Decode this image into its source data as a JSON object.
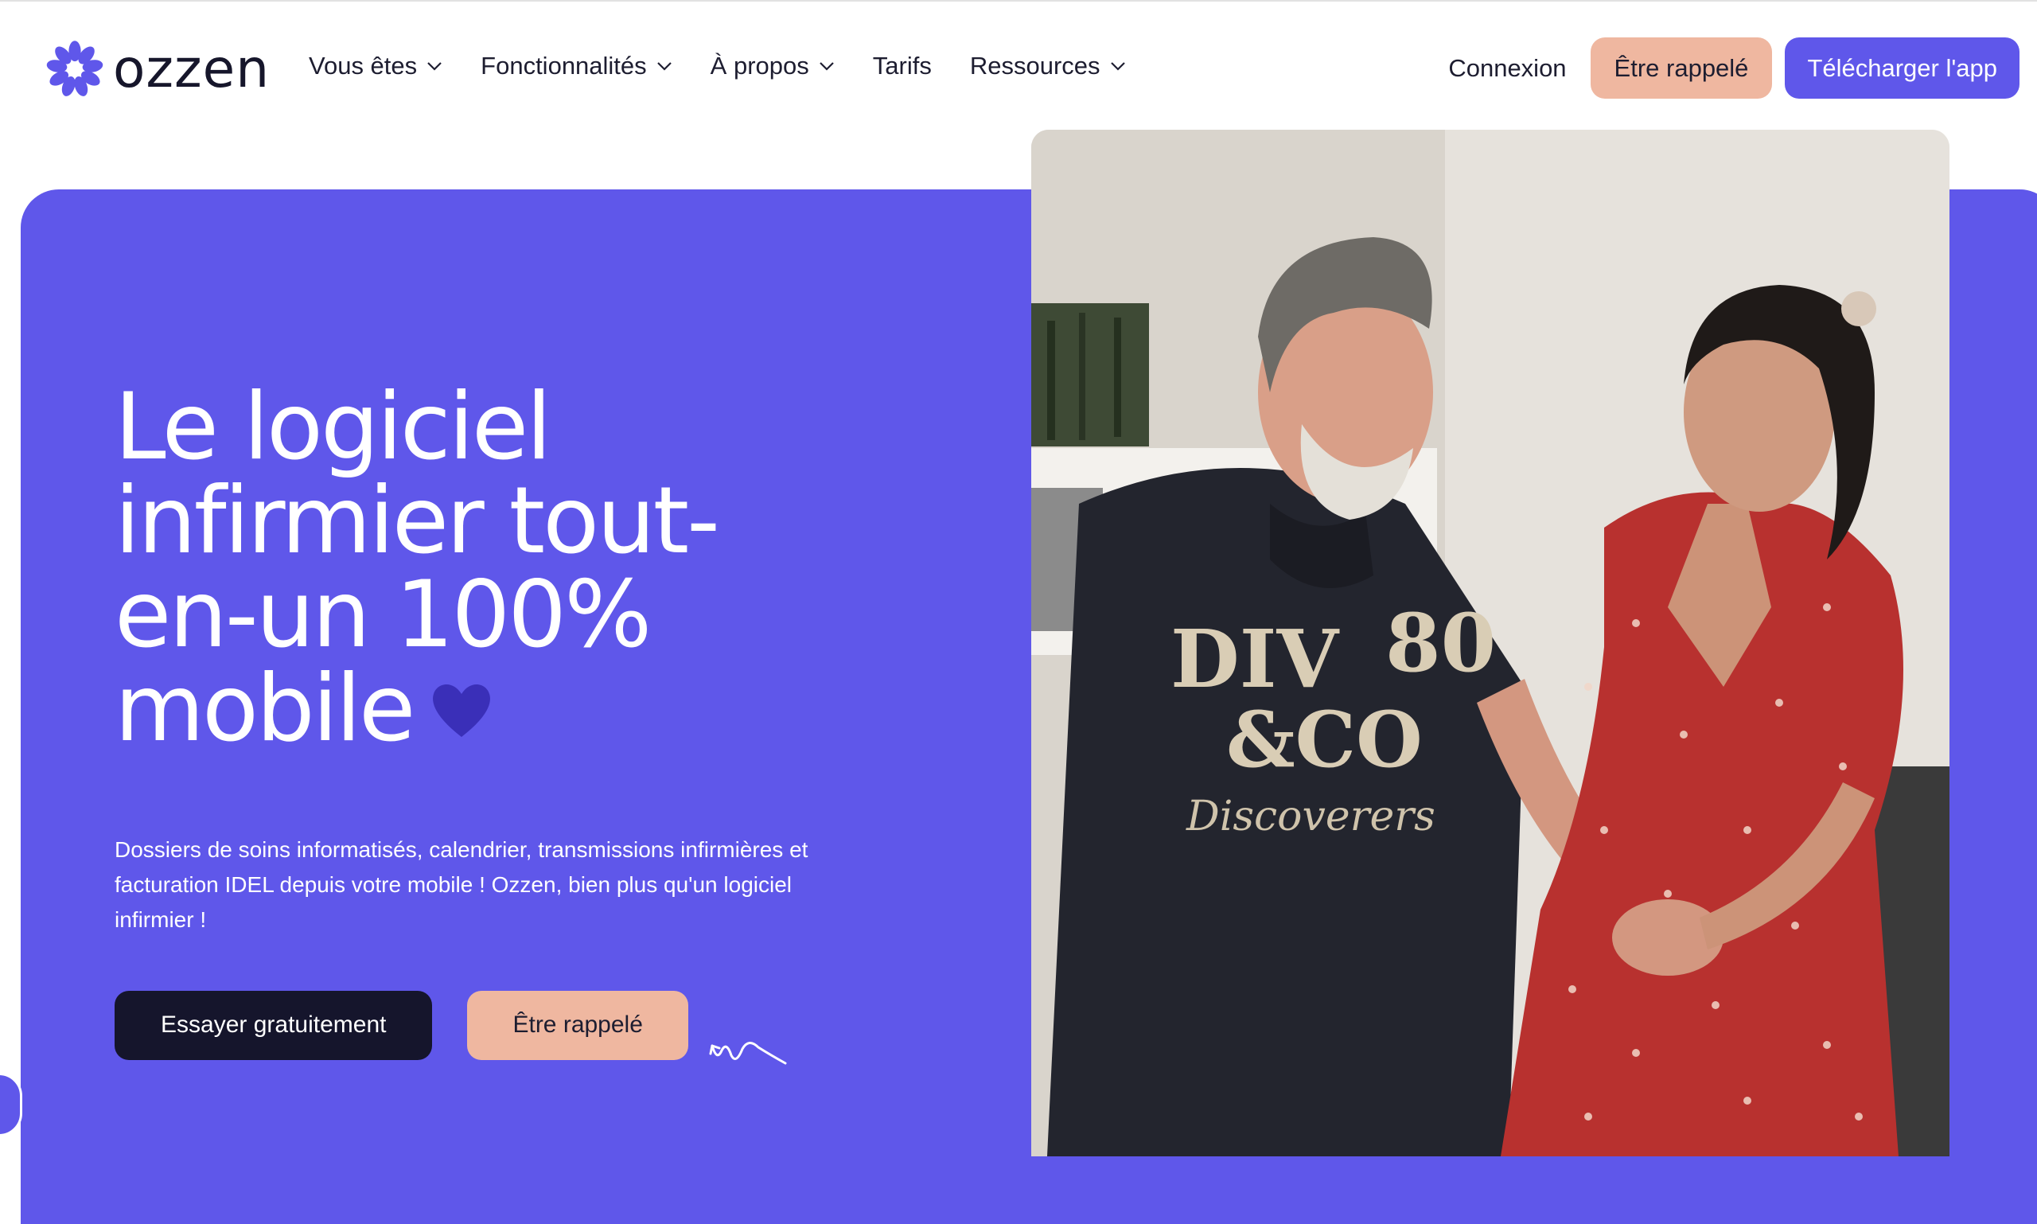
{
  "brand": {
    "name": "ozzen",
    "logo_icon": "flower-icon",
    "color": "#5f57ea"
  },
  "nav": {
    "items": [
      {
        "label": "Vous êtes",
        "has_dropdown": true
      },
      {
        "label": "Fonctionnalités",
        "has_dropdown": true
      },
      {
        "label": "À propos",
        "has_dropdown": true
      },
      {
        "label": "Tarifs",
        "has_dropdown": false
      },
      {
        "label": "Ressources",
        "has_dropdown": true
      }
    ],
    "login_label": "Connexion",
    "callback_label": "Être rappelé",
    "download_label": "Télécharger l'app"
  },
  "hero": {
    "title_lines": [
      "Le logiciel",
      "infirmier tout-",
      "en-un 100%",
      "mobile"
    ],
    "subtitle": "Dossiers de soins informatisés, calendrier, transmissions infirmières et facturation IDEL depuis votre mobile ! Ozzen, bien plus qu'un logiciel infirmier !",
    "primary_cta": "Essayer gratuitement",
    "secondary_cta": "Être rappelé",
    "image": "photo of an elderly man and a smiling nurse holding hands"
  },
  "colors": {
    "primary": "#5f57ea",
    "dark": "#15152c",
    "peach": "#efb7a0",
    "heart": "#3a2fb8"
  }
}
